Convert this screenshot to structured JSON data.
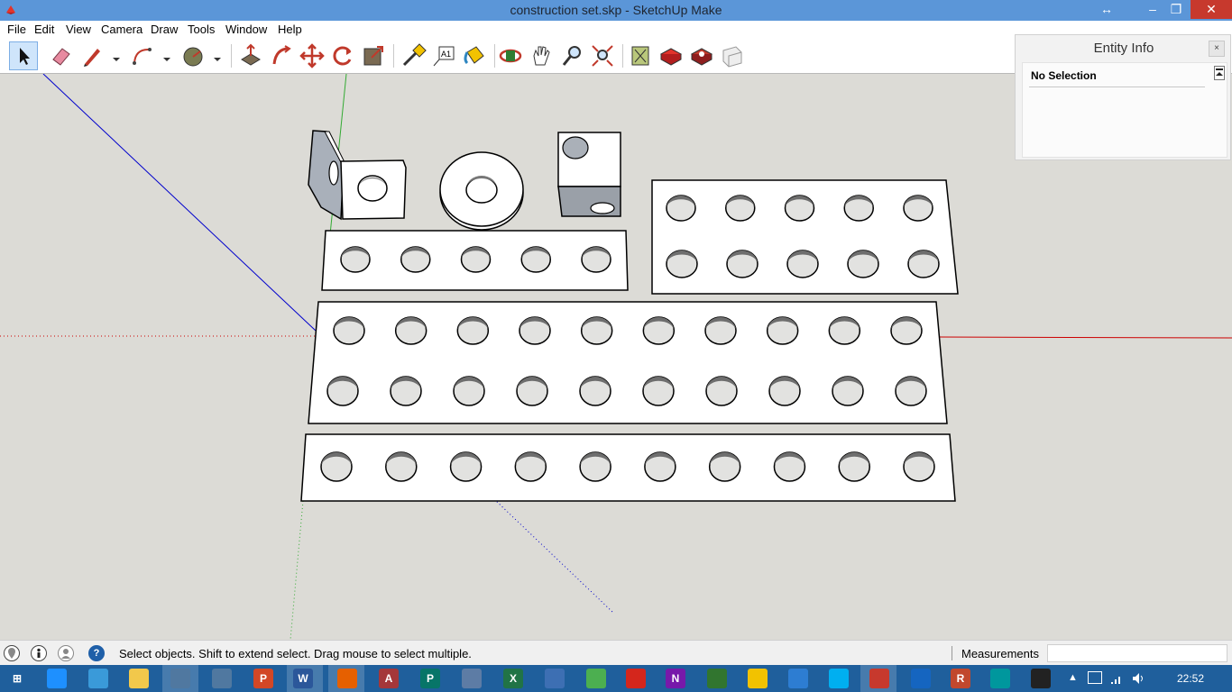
{
  "window": {
    "title": "construction set.skp - SketchUp Make",
    "resize_glyph": "↔",
    "minimize_glyph": "–",
    "restore_glyph": "❐",
    "close_glyph": "✕"
  },
  "menu": [
    "File",
    "Edit",
    "View",
    "Camera",
    "Draw",
    "Tools",
    "Window",
    "Help"
  ],
  "toolbar": {
    "tools": [
      "select-icon",
      "eraser-icon",
      "pencil-icon",
      "arc-icon",
      "paint-icon",
      "push-pull-icon",
      "follow-me-icon",
      "move-icon",
      "rotate-icon",
      "scale-icon",
      "tape-measure-icon",
      "text-icon",
      "paint-bucket-icon",
      "orbit-icon",
      "pan-icon",
      "zoom-icon",
      "zoom-extents-icon",
      "warehouse-icon",
      "extension-icon",
      "components-icon",
      "layout-icon"
    ],
    "selected": "select-icon"
  },
  "entity_info": {
    "title": "Entity Info",
    "close_glyph": "×",
    "selection": "No Selection"
  },
  "status": {
    "hint": "Select objects. Shift to extend select. Drag mouse to select multiple.",
    "help_glyph": "?",
    "measurements_label": "Measurements",
    "measurements_value": ""
  },
  "taskbar": {
    "clock": "22:52",
    "apps": [
      "start-icon",
      "internet-explorer-icon",
      "network-icon",
      "file-explorer-icon",
      "sketchup-layout-icon",
      "sketchup-style-icon",
      "powerpoint-icon",
      "word-icon",
      "firefox-icon",
      "access-icon",
      "publisher-icon",
      "remote-desktop-icon",
      "excel-icon",
      "calculator-icon",
      "chrome-icon",
      "acrobat-icon",
      "onenote-icon",
      "project-icon",
      "sticky-notes-icon",
      "settings-icon",
      "skype-icon",
      "sketchup-icon",
      "ccleaner-icon",
      "r-icon",
      "arduino-icon",
      "inkscape-icon"
    ]
  },
  "colors": {
    "titlebar": "#5b96d8",
    "viewport": "#dcdbd6",
    "taskbar": "#1f5f9c",
    "axis_red": "#cc0000",
    "axis_green": "#33aa33",
    "axis_blue": "#0000cc"
  }
}
